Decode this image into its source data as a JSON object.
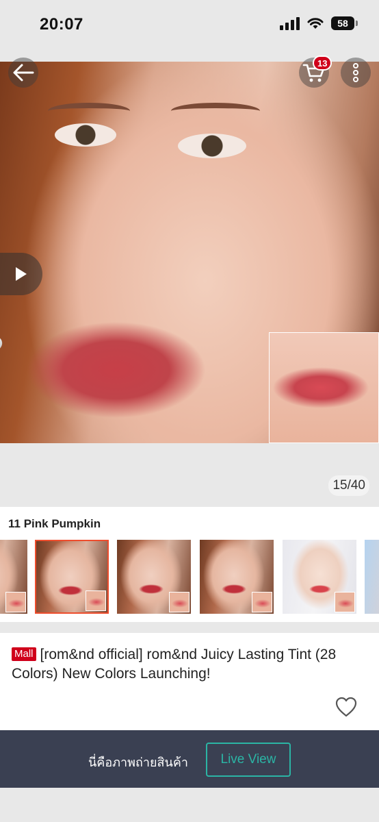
{
  "status_bar": {
    "time": "20:07",
    "battery": "58"
  },
  "header": {
    "back_icon": "arrow-left-icon",
    "cart_icon": "shopping-cart-icon",
    "cart_count": "13",
    "more_icon": "vertical-dots-icon"
  },
  "gallery": {
    "image_index": "15/40",
    "play_icon": "play-icon"
  },
  "variation": {
    "selected_name": "11 Pink Pumpkin",
    "thumbnails": [
      "thumb-1",
      "thumb-2",
      "thumb-3",
      "thumb-4",
      "thumb-5",
      "thumb-6"
    ],
    "selected_index": 1
  },
  "product": {
    "mall_badge": "Mall",
    "title": "[rom&nd official] rom&nd Juicy Lasting Tint (28 Colors) New Colors Launching!",
    "like_icon": "heart-outline-icon"
  },
  "live_bar": {
    "text": "นี่คือภาพถ่ายสินค้า",
    "button": "Live View"
  },
  "colors": {
    "accent": "#ee4d2d",
    "mall_red": "#d0011b",
    "live_teal": "#2bb5a5",
    "live_bar_bg": "#3a4052"
  }
}
